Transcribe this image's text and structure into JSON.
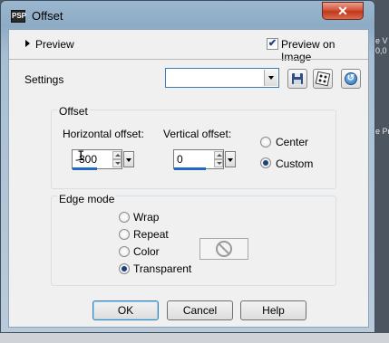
{
  "window": {
    "title": "Offset",
    "close_glyph": "✕",
    "app_icon_text": "PSP"
  },
  "preview": {
    "label": "Preview",
    "preview_on_image_label": "Preview on Image",
    "preview_on_image_checked": true
  },
  "settings": {
    "label": "Settings",
    "value": ""
  },
  "offset": {
    "group_title": "Offset",
    "horizontal_label": "Horizontal offset:",
    "horizontal_value": "-300",
    "vertical_label": "Vertical offset:",
    "vertical_value": "0",
    "mode_options": [
      {
        "label": "Center",
        "selected": false
      },
      {
        "label": "Custom",
        "selected": true
      }
    ]
  },
  "edge_mode": {
    "group_title": "Edge mode",
    "options": [
      {
        "label": "Wrap",
        "selected": false
      },
      {
        "label": "Repeat",
        "selected": false
      },
      {
        "label": "Color",
        "selected": false
      },
      {
        "label": "Transparent",
        "selected": true
      }
    ]
  },
  "buttons": {
    "ok": "OK",
    "cancel": "Cancel",
    "help": "Help"
  },
  "background_text": {
    "line1": "e V",
    "line2": "0,0",
    "line3": "e Pr"
  },
  "colors": {
    "titlebar": "#9bb7cf",
    "close": "#c3381c",
    "client": "#f0f0f0",
    "accent": "#1f67c8"
  }
}
